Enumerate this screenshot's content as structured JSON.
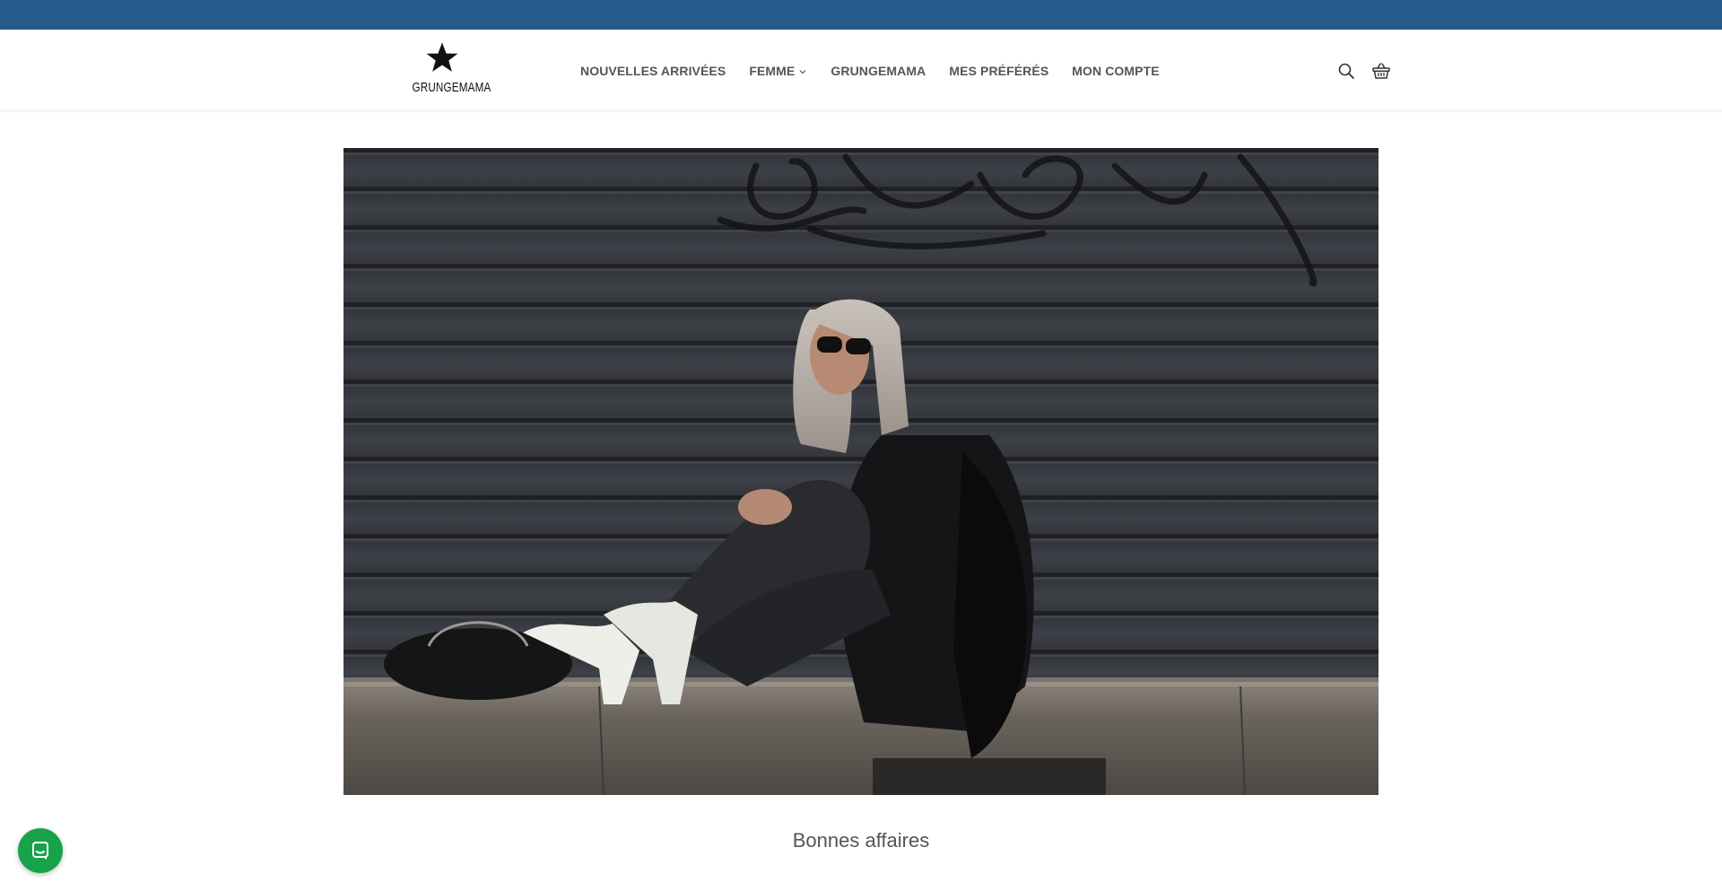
{
  "announcement_bar": {
    "color": "#245a8c"
  },
  "header": {
    "logo": {
      "text": "GRUNGEMAMA",
      "icon": "star-icon"
    },
    "nav": [
      {
        "label": "NOUVELLES ARRIVÉES",
        "has_dropdown": false
      },
      {
        "label": "FEMME",
        "has_dropdown": true,
        "icon": "chevron-down-icon"
      },
      {
        "label": "GRUNGEMAMA",
        "has_dropdown": false
      },
      {
        "label": "MES PRÉFÉRÉS",
        "has_dropdown": false
      },
      {
        "label": "MON COMPTE",
        "has_dropdown": false
      }
    ],
    "icons": {
      "search": "search-icon",
      "cart": "basket-icon"
    }
  },
  "hero": {
    "image": "woman-sitting-on-street-curb-photo"
  },
  "section": {
    "heading": "Bonnes affaires"
  },
  "chat": {
    "icon": "chat-bubble-icon",
    "color": "#18a34a"
  }
}
